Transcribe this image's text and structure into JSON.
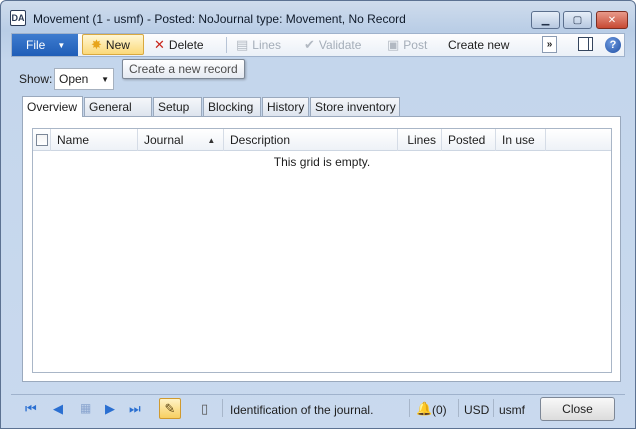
{
  "window": {
    "app_icon_text": "DA",
    "title": "Movement (1 - usmf) - Posted: NoJournal type: Movement, No Record",
    "minimize_glyph": "▁",
    "maximize_glyph": "▢",
    "close_glyph": "✕"
  },
  "action_pane": {
    "file_label": "File",
    "new_label": "New",
    "delete_label": "Delete",
    "lines_label": "Lines",
    "validate_label": "Validate",
    "post_label": "Post",
    "create_new_label": "Create new",
    "more_glyph": "»",
    "help_glyph": "?"
  },
  "tooltip": {
    "text": "Create a new record"
  },
  "filter": {
    "show_label": "Show:",
    "show_value": "Open"
  },
  "tabs": [
    {
      "label": "Overview",
      "active": true
    },
    {
      "label": "General",
      "active": false
    },
    {
      "label": "Setup",
      "active": false
    },
    {
      "label": "Blocking",
      "active": false
    },
    {
      "label": "History",
      "active": false
    },
    {
      "label": "Store inventory",
      "active": false
    }
  ],
  "grid": {
    "columns": [
      "Name",
      "Journal",
      "Description",
      "Lines",
      "Posted",
      "In use"
    ],
    "sorted_column": "Journal",
    "sort_direction": "ascending",
    "empty_text": "This grid is empty."
  },
  "status_bar": {
    "help_text": "Identification of the journal.",
    "notifications": "(0)",
    "currency": "USD",
    "company": "usmf",
    "close_label": "Close"
  },
  "colors": {
    "accent": "#1f5db7",
    "highlight": "#fbd97a",
    "nav_blue": "#2a6fd1"
  }
}
